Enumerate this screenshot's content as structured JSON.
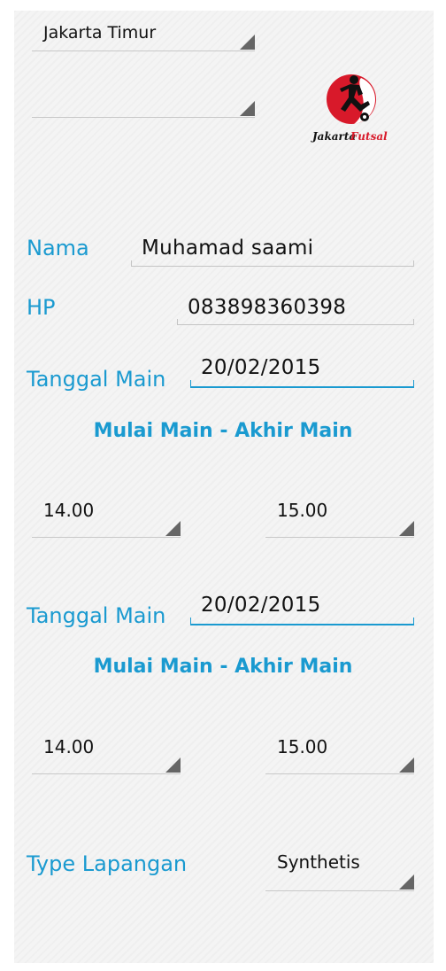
{
  "location": {
    "region_value": "Jakarta Timur",
    "sub_value": ""
  },
  "logo": {
    "text_black": "Jakarta",
    "text_red": "Futsal",
    "colors": {
      "red": "#d8192a",
      "black": "#111111"
    }
  },
  "form": {
    "nama_label": "Nama",
    "nama_value": "Muhamad saami",
    "hp_label": "HP",
    "hp_value": "083898360398"
  },
  "booking_1": {
    "date_label": "Tanggal Main",
    "date_value": "20/02/2015",
    "time_heading": "Mulai Main - Akhir Main",
    "start_value": "14.00",
    "end_value": "15.00"
  },
  "booking_2": {
    "date_label": "Tanggal Main",
    "date_value": "20/02/2015",
    "time_heading": "Mulai Main - Akhir Main",
    "start_value": "14.00",
    "end_value": "15.00"
  },
  "field_type": {
    "label": "Type Lapangan",
    "value": "Synthetis"
  },
  "colors": {
    "accent": "#1a9ad0",
    "panel": "#f4f4f4"
  },
  "icons": {
    "spinner_arrow": "dropdown-triangle-icon"
  }
}
